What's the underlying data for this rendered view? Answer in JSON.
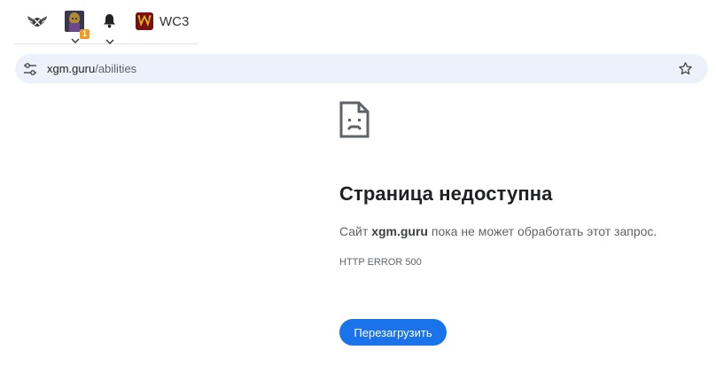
{
  "site_toolbar": {
    "logo_icon": "winged-shield-logo-icon",
    "avatar_icon": "user-avatar-icon",
    "notification_count": "1",
    "bell_icon": "notification-bell-icon",
    "wc3_icon": "warcraft-w-icon",
    "wc3_label": "WC3",
    "badge_color": "#f29a1f"
  },
  "omnibox": {
    "tune_icon": "site-info-tune-icon",
    "url_host": "xgm.guru",
    "url_path": "/abilities",
    "star_icon": "bookmark-star-icon"
  },
  "error_page": {
    "icon": "broken-page-icon",
    "title": "Страница недоступна",
    "desc_prefix": "Сайт ",
    "desc_host": "xgm.guru",
    "desc_suffix": " пока не может обработать этот запрос.",
    "error_code": "HTTP ERROR 500",
    "reload_label": "Перезагрузить",
    "button_color": "#1a73e8"
  }
}
